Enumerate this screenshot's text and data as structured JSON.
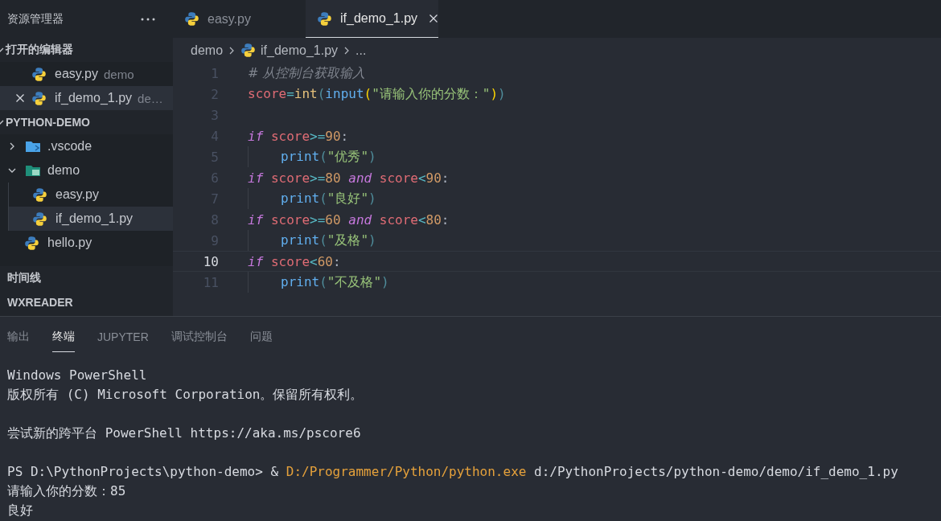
{
  "sidebar": {
    "title": "资源管理器",
    "open_editors": {
      "title": "打开的编辑器",
      "expanded": true,
      "items": [
        {
          "name": "easy.py",
          "folder": "demo",
          "selected": false
        },
        {
          "name": "if_demo_1.py",
          "folder": "de…",
          "selected": true
        }
      ]
    },
    "project": {
      "title": "PYTHON-DEMO",
      "expanded": true,
      "tree": [
        {
          "label": ".vscode",
          "kind": "folder-vscode",
          "expanded": false,
          "selected": false
        },
        {
          "label": "demo",
          "kind": "folder",
          "expanded": true,
          "selected": false,
          "children": [
            {
              "label": "easy.py",
              "kind": "python",
              "selected": false
            },
            {
              "label": "if_demo_1.py",
              "kind": "python",
              "selected": true
            }
          ]
        },
        {
          "label": "hello.py",
          "kind": "python",
          "selected": false
        }
      ]
    },
    "sections": [
      "时间线",
      "WXREADER"
    ]
  },
  "editor": {
    "tabs": [
      {
        "name": "easy.py",
        "selected": false
      },
      {
        "name": "if_demo_1.py",
        "selected": true
      }
    ],
    "breadcrumb": [
      {
        "text": "demo",
        "kind": "folder"
      },
      {
        "text": "if_demo_1.py",
        "kind": "file"
      },
      {
        "text": "...",
        "kind": "more"
      }
    ],
    "lines": [
      {
        "number": "1",
        "selected": false,
        "indent": false,
        "tokens": [
          {
            "text": "# 从控制台获取输入",
            "kind": "comment"
          }
        ]
      },
      {
        "number": "2",
        "selected": false,
        "indent": false,
        "tokens": [
          {
            "text": "score",
            "kind": "var"
          },
          {
            "text": "=",
            "kind": "op"
          },
          {
            "text": "int",
            "kind": "builtin"
          },
          {
            "text": "(",
            "kind": "bracket-a"
          },
          {
            "text": "input",
            "kind": "func"
          },
          {
            "text": "(",
            "kind": "bracket-b"
          },
          {
            "text": "\"请输入你的分数：\"",
            "kind": "string"
          },
          {
            "text": ")",
            "kind": "bracket-b"
          },
          {
            "text": ")",
            "kind": "bracket-a"
          }
        ]
      },
      {
        "number": "3",
        "selected": false,
        "indent": false
      },
      {
        "number": "4",
        "selected": false,
        "indent": false,
        "tokens": [
          {
            "text": "if ",
            "kind": "keyword"
          },
          {
            "text": "score",
            "kind": "var"
          },
          {
            "text": ">=",
            "kind": "op"
          },
          {
            "text": "90",
            "kind": "number"
          },
          {
            "text": ":",
            "kind": "punct"
          }
        ]
      },
      {
        "number": "5",
        "selected": false,
        "indent": true,
        "tokens": [
          {
            "text": "print",
            "kind": "func"
          },
          {
            "text": "(",
            "kind": "bracket-a"
          },
          {
            "text": "\"优秀\"",
            "kind": "string"
          },
          {
            "text": ")",
            "kind": "bracket-a"
          }
        ]
      },
      {
        "number": "6",
        "selected": false,
        "indent": false,
        "tokens": [
          {
            "text": "if ",
            "kind": "keyword"
          },
          {
            "text": "score",
            "kind": "var"
          },
          {
            "text": ">=",
            "kind": "op"
          },
          {
            "text": "80",
            "kind": "number"
          },
          {
            "text": " and ",
            "kind": "keyword"
          },
          {
            "text": "score",
            "kind": "var"
          },
          {
            "text": "<",
            "kind": "op"
          },
          {
            "text": "90",
            "kind": "number"
          },
          {
            "text": ":",
            "kind": "punct"
          }
        ]
      },
      {
        "number": "7",
        "selected": false,
        "indent": true,
        "tokens": [
          {
            "text": "print",
            "kind": "func"
          },
          {
            "text": "(",
            "kind": "bracket-a"
          },
          {
            "text": "\"良好\"",
            "kind": "string"
          },
          {
            "text": ")",
            "kind": "bracket-a"
          }
        ]
      },
      {
        "number": "8",
        "selected": false,
        "indent": false,
        "tokens": [
          {
            "text": "if ",
            "kind": "keyword"
          },
          {
            "text": "score",
            "kind": "var"
          },
          {
            "text": ">=",
            "kind": "op"
          },
          {
            "text": "60",
            "kind": "number"
          },
          {
            "text": " and ",
            "kind": "keyword"
          },
          {
            "text": "score",
            "kind": "var"
          },
          {
            "text": "<",
            "kind": "op"
          },
          {
            "text": "80",
            "kind": "number"
          },
          {
            "text": ":",
            "kind": "punct"
          }
        ]
      },
      {
        "number": "9",
        "selected": false,
        "indent": true,
        "tokens": [
          {
            "text": "print",
            "kind": "func"
          },
          {
            "text": "(",
            "kind": "bracket-a"
          },
          {
            "text": "\"及格\"",
            "kind": "string"
          },
          {
            "text": ")",
            "kind": "bracket-a"
          }
        ]
      },
      {
        "number": "10",
        "selected": true,
        "indent": false,
        "tokens": [
          {
            "text": "if ",
            "kind": "keyword"
          },
          {
            "text": "score",
            "kind": "var"
          },
          {
            "text": "<",
            "kind": "op"
          },
          {
            "text": "60",
            "kind": "number"
          },
          {
            "text": ":",
            "kind": "punct"
          }
        ]
      },
      {
        "number": "11",
        "selected": false,
        "indent": true,
        "tokens": [
          {
            "text": "print",
            "kind": "func"
          },
          {
            "text": "(",
            "kind": "bracket-a"
          },
          {
            "text": "\"不及格\"",
            "kind": "string"
          },
          {
            "text": ")",
            "kind": "bracket-a"
          }
        ]
      }
    ]
  },
  "panel": {
    "tabs": [
      {
        "label": "输出",
        "selected": false
      },
      {
        "label": "终端",
        "selected": true
      },
      {
        "label": "JUPYTER",
        "selected": false
      },
      {
        "label": "调试控制台",
        "selected": false
      },
      {
        "label": "问题",
        "selected": false
      }
    ],
    "terminal": [
      {
        "spaced": false,
        "segments": [
          {
            "text": "Windows PowerShell",
            "kind": "plain"
          }
        ]
      },
      {
        "spaced": false,
        "segments": [
          {
            "text": "版权所有 (C) Microsoft Corporation。保留所有权利。",
            "kind": "plain"
          }
        ]
      },
      {
        "spaced": true,
        "segments": [
          {
            "text": "尝试新的跨平台 PowerShell https://aka.ms/pscore6",
            "kind": "plain"
          }
        ]
      },
      {
        "spaced": true,
        "segments": [
          {
            "text": "PS D:\\PythonProjects\\python-demo> & ",
            "kind": "plain"
          },
          {
            "text": "D:/Programmer/Python/python.exe",
            "kind": "command"
          },
          {
            "text": " d:/PythonProjects/python-demo/demo/if_demo_1.py",
            "kind": "plain"
          }
        ]
      },
      {
        "spaced": false,
        "segments": [
          {
            "text": "请输入你的分数：85",
            "kind": "plain"
          }
        ]
      },
      {
        "spaced": false,
        "segments": [
          {
            "text": "良好",
            "kind": "plain"
          }
        ]
      }
    ]
  }
}
